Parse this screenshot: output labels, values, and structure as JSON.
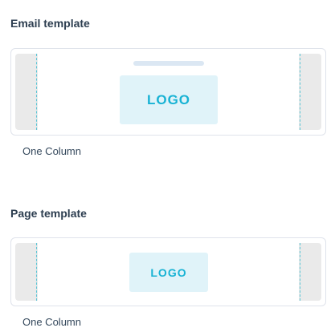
{
  "email_section": {
    "title": "Email template",
    "logo_text": "LOGO",
    "caption": "One Column"
  },
  "page_section": {
    "title": "Page template",
    "logo_text": "LOGO",
    "caption": "One Column"
  },
  "colors": {
    "title": "#2d3e50",
    "caption": "#33475b",
    "card_border": "#dfe3eb",
    "gutter": "#eaeaea",
    "guide": "#5cc5d6",
    "logo_bg": "#e0f3f9",
    "logo_text": "#17b2d4",
    "header_bar": "#dbe7f3"
  }
}
